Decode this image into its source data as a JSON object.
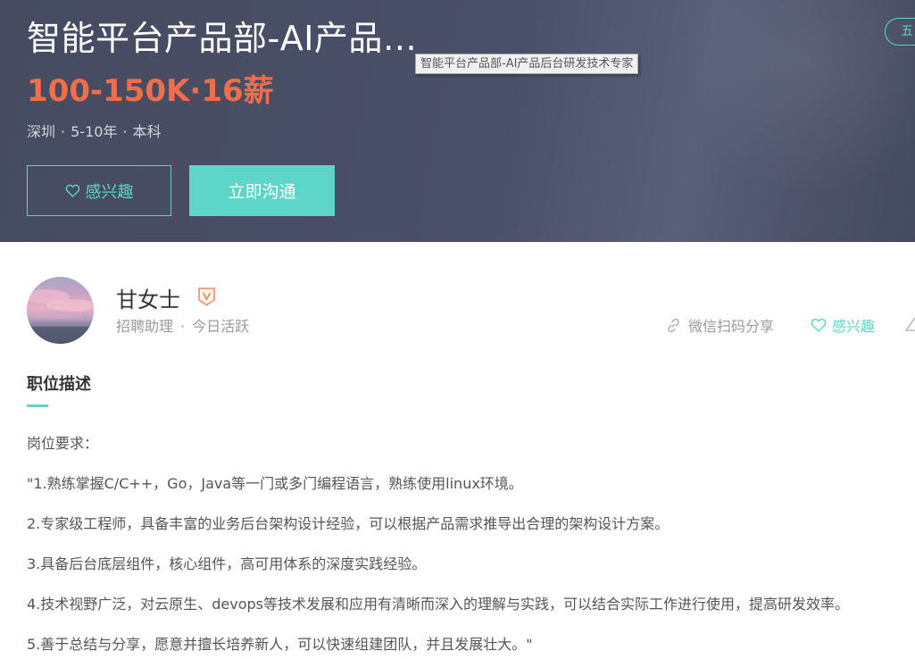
{
  "header": {
    "job_title": "智能平台产品部-AI产品…",
    "tooltip": "智能平台产品部-AI产品后台研发技术专家",
    "salary": "100-150K·16薪",
    "meta": [
      "深圳",
      "5-10年",
      "本科"
    ],
    "meta_separator": "·",
    "interest_button": "感兴趣",
    "chat_button": "立即沟通",
    "right_badge": "五"
  },
  "recruiter": {
    "name": "甘女士",
    "role": "招聘助理",
    "separator": "·",
    "status": "今日活跃"
  },
  "actions": {
    "share": "微信扫码分享",
    "interest": "感兴趣"
  },
  "description": {
    "section_title": "职位描述",
    "lines": [
      "岗位要求：",
      "\"1.熟练掌握C/C++，Go，Java等一门或多门编程语言，熟练使用linux环境。",
      "2.专家级工程师，具备丰富的业务后台架构设计经验，可以根据产品需求推导出合理的架构设计方案。",
      "3.具备后台底层组件，核心组件，高可用体系的深度实践经验。",
      "4.技术视野广泛，对云原生、devops等技术发展和应用有清晰而深入的理解与实践，可以结合实际工作进行使用，提高研发效率。",
      "5.善于总结与分享，愿意并擅长培养新人，可以快速组建团队，并且发展壮大。\""
    ]
  },
  "colors": {
    "accent": "#5dd5c8",
    "salary": "#f26d4a",
    "header_bg": "#4a5068",
    "verified_badge": "#f28a5c"
  },
  "icons": [
    "heart-outline-icon",
    "verified-v-icon",
    "link-icon",
    "report-icon"
  ]
}
